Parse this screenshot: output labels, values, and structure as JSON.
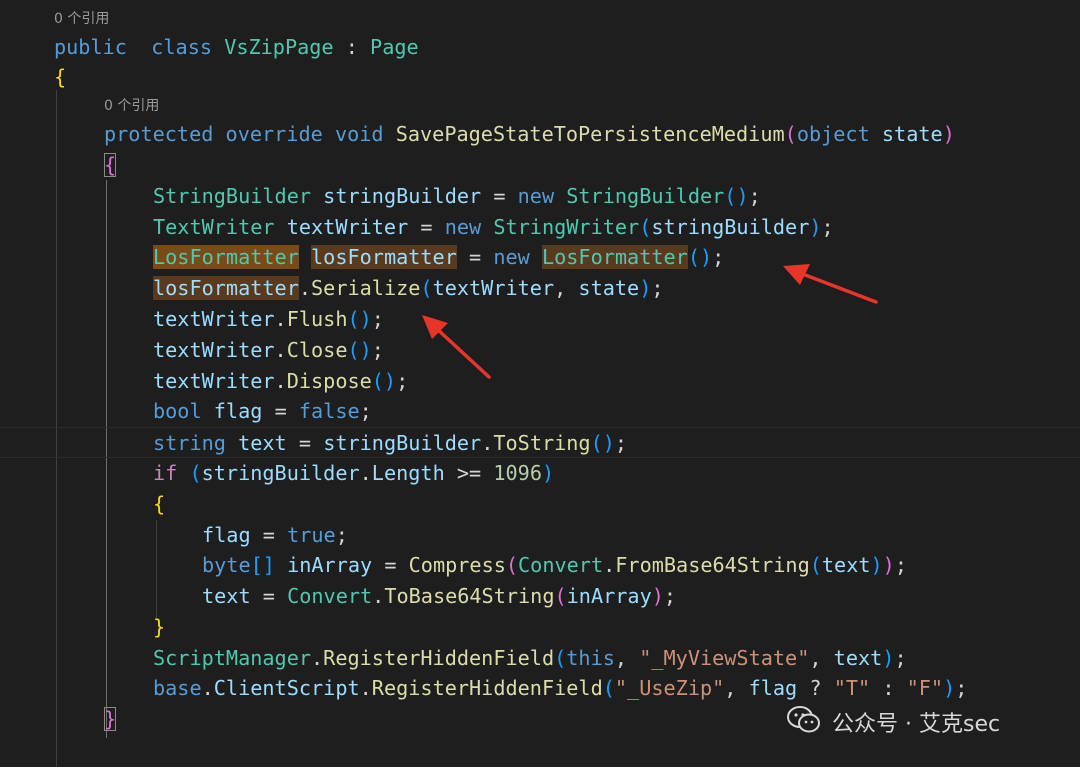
{
  "colors": {
    "background": "#1e1e1e",
    "keyword": "#569cd6",
    "type": "#4ec9b0",
    "variable": "#9cdcfe",
    "function": "#dcdcaa",
    "string": "#ce9178",
    "number": "#b5cea8",
    "highlight": "#5a3a1e",
    "arrow": "#e8352a"
  },
  "code_lens": [
    {
      "text": "0 个引用"
    },
    {
      "text": "0 个引用"
    }
  ],
  "watermark": {
    "icon": "wechat-icon",
    "text": "公众号 · 艾克sec"
  },
  "annotations": [
    {
      "icon": "red-arrow-icon",
      "points_to": "LosFormatter losFormatter = new LosFormatter();"
    },
    {
      "icon": "red-arrow-icon",
      "points_to": "losFormatter.Serialize(textWriter, state);"
    }
  ],
  "code_lines": [
    {
      "lens": 0
    },
    {
      "tokens": [
        [
          "kw",
          "public"
        ],
        [
          "",
          "  "
        ],
        [
          "kw",
          "class"
        ],
        [
          "",
          " "
        ],
        [
          "type",
          "VsZipPage"
        ],
        [
          "",
          " "
        ],
        [
          "op",
          ":"
        ],
        [
          "",
          " "
        ],
        [
          "type",
          "Page"
        ]
      ]
    },
    {
      "tokens": [
        [
          "b1",
          "{"
        ]
      ]
    },
    {
      "lens": 1
    },
    {
      "tokens": [
        [
          "kw",
          "protected"
        ],
        [
          "",
          " "
        ],
        [
          "kw",
          "override"
        ],
        [
          "",
          " "
        ],
        [
          "kw",
          "void"
        ],
        [
          "",
          " "
        ],
        [
          "fn",
          "SavePageStateToPersistenceMedium"
        ],
        [
          "b2",
          "("
        ],
        [
          "kw",
          "object"
        ],
        [
          "",
          " "
        ],
        [
          "var",
          "state"
        ],
        [
          "b2",
          ")"
        ]
      ]
    },
    {
      "tokens": [
        [
          "b2 match",
          "{"
        ]
      ]
    },
    {
      "tokens": [
        [
          "type",
          "StringBuilder"
        ],
        [
          "",
          " "
        ],
        [
          "var",
          "stringBuilder"
        ],
        [
          "",
          " "
        ],
        [
          "op",
          "="
        ],
        [
          "",
          " "
        ],
        [
          "kw",
          "new"
        ],
        [
          "",
          " "
        ],
        [
          "type",
          "StringBuilder"
        ],
        [
          "b3",
          "()"
        ],
        [
          "pun",
          ";"
        ]
      ]
    },
    {
      "tokens": [
        [
          "type",
          "TextWriter"
        ],
        [
          "",
          " "
        ],
        [
          "var",
          "textWriter"
        ],
        [
          "",
          " "
        ],
        [
          "op",
          "="
        ],
        [
          "",
          " "
        ],
        [
          "kw",
          "new"
        ],
        [
          "",
          " "
        ],
        [
          "type",
          "StringWriter"
        ],
        [
          "b3",
          "("
        ],
        [
          "var",
          "stringBuilder"
        ],
        [
          "b3",
          ")"
        ],
        [
          "pun",
          ";"
        ]
      ]
    },
    {
      "tokens": [
        [
          "type hl2",
          "LosFormatter"
        ],
        [
          "",
          " "
        ],
        [
          "var hl",
          "losFormatter"
        ],
        [
          "",
          " "
        ],
        [
          "op",
          "="
        ],
        [
          "",
          " "
        ],
        [
          "kw",
          "new"
        ],
        [
          "",
          " "
        ],
        [
          "type hl",
          "LosFormatter"
        ],
        [
          "b3",
          "()"
        ],
        [
          "pun",
          ";"
        ]
      ]
    },
    {
      "tokens": [
        [
          "var hl",
          "losFormatter"
        ],
        [
          "pun",
          "."
        ],
        [
          "fn",
          "Serialize"
        ],
        [
          "b3",
          "("
        ],
        [
          "var",
          "textWriter"
        ],
        [
          "pun",
          ","
        ],
        [
          "",
          " "
        ],
        [
          "var",
          "state"
        ],
        [
          "b3",
          ")"
        ],
        [
          "pun",
          ";"
        ]
      ]
    },
    {
      "tokens": [
        [
          "var",
          "textWriter"
        ],
        [
          "pun",
          "."
        ],
        [
          "fn",
          "Flush"
        ],
        [
          "b3",
          "()"
        ],
        [
          "pun",
          ";"
        ]
      ]
    },
    {
      "tokens": [
        [
          "var",
          "textWriter"
        ],
        [
          "pun",
          "."
        ],
        [
          "fn",
          "Close"
        ],
        [
          "b3",
          "()"
        ],
        [
          "pun",
          ";"
        ]
      ]
    },
    {
      "tokens": [
        [
          "var",
          "textWriter"
        ],
        [
          "pun",
          "."
        ],
        [
          "fn",
          "Dispose"
        ],
        [
          "b3",
          "()"
        ],
        [
          "pun",
          ";"
        ]
      ]
    },
    {
      "tokens": [
        [
          "kw",
          "bool"
        ],
        [
          "",
          " "
        ],
        [
          "var",
          "flag"
        ],
        [
          "",
          " "
        ],
        [
          "op",
          "="
        ],
        [
          "",
          " "
        ],
        [
          "kw",
          "false"
        ],
        [
          "pun",
          ";"
        ]
      ]
    },
    {
      "tokens": [
        [
          "kw",
          "string"
        ],
        [
          "",
          " "
        ],
        [
          "var",
          "text"
        ],
        [
          "",
          " "
        ],
        [
          "op",
          "="
        ],
        [
          "",
          " "
        ],
        [
          "var",
          "stringBuilder"
        ],
        [
          "pun",
          "."
        ],
        [
          "fn",
          "ToString"
        ],
        [
          "b3",
          "()"
        ],
        [
          "pun",
          ";"
        ]
      ]
    },
    {
      "tokens": [
        [
          "ctl",
          "if"
        ],
        [
          "",
          " "
        ],
        [
          "b3",
          "("
        ],
        [
          "var",
          "stringBuilder"
        ],
        [
          "pun",
          "."
        ],
        [
          "var",
          "Length"
        ],
        [
          "",
          " "
        ],
        [
          "op",
          ">="
        ],
        [
          "",
          " "
        ],
        [
          "num",
          "1096"
        ],
        [
          "b3",
          ")"
        ]
      ]
    },
    {
      "tokens": [
        [
          "b1",
          "{"
        ]
      ]
    },
    {
      "tokens": [
        [
          "var",
          "flag"
        ],
        [
          "",
          " "
        ],
        [
          "op",
          "="
        ],
        [
          "",
          " "
        ],
        [
          "kw",
          "true"
        ],
        [
          "pun",
          ";"
        ]
      ]
    },
    {
      "tokens": [
        [
          "kw",
          "byte"
        ],
        [
          "b3",
          "[]"
        ],
        [
          "",
          " "
        ],
        [
          "var",
          "inArray"
        ],
        [
          "",
          " "
        ],
        [
          "op",
          "="
        ],
        [
          "",
          " "
        ],
        [
          "fn",
          "Compress"
        ],
        [
          "b2",
          "("
        ],
        [
          "type",
          "Convert"
        ],
        [
          "pun",
          "."
        ],
        [
          "fn",
          "FromBase64String"
        ],
        [
          "b3",
          "("
        ],
        [
          "var",
          "text"
        ],
        [
          "b3",
          ")"
        ],
        [
          "b2",
          ")"
        ],
        [
          "pun",
          ";"
        ]
      ]
    },
    {
      "tokens": [
        [
          "var",
          "text"
        ],
        [
          "",
          " "
        ],
        [
          "op",
          "="
        ],
        [
          "",
          " "
        ],
        [
          "type",
          "Convert"
        ],
        [
          "pun",
          "."
        ],
        [
          "fn",
          "ToBase64String"
        ],
        [
          "b2",
          "("
        ],
        [
          "var",
          "inArray"
        ],
        [
          "b2",
          ")"
        ],
        [
          "pun",
          ";"
        ]
      ]
    },
    {
      "tokens": [
        [
          "b1",
          "}"
        ]
      ]
    },
    {
      "tokens": [
        [
          "type",
          "ScriptManager"
        ],
        [
          "pun",
          "."
        ],
        [
          "fn",
          "RegisterHiddenField"
        ],
        [
          "b3",
          "("
        ],
        [
          "kw",
          "this"
        ],
        [
          "pun",
          ","
        ],
        [
          "",
          " "
        ],
        [
          "str",
          "\"_MyViewState\""
        ],
        [
          "pun",
          ","
        ],
        [
          "",
          " "
        ],
        [
          "var",
          "text"
        ],
        [
          "b3",
          ")"
        ],
        [
          "pun",
          ";"
        ]
      ]
    },
    {
      "tokens": [
        [
          "kw",
          "base"
        ],
        [
          "pun",
          "."
        ],
        [
          "var",
          "ClientScript"
        ],
        [
          "pun",
          "."
        ],
        [
          "fn",
          "RegisterHiddenField"
        ],
        [
          "b3",
          "("
        ],
        [
          "str",
          "\"_UseZip\""
        ],
        [
          "pun",
          ","
        ],
        [
          "",
          " "
        ],
        [
          "var",
          "flag"
        ],
        [
          "",
          " "
        ],
        [
          "op",
          "?"
        ],
        [
          "",
          " "
        ],
        [
          "str",
          "\"T\""
        ],
        [
          "",
          " "
        ],
        [
          "op",
          ":"
        ],
        [
          "",
          " "
        ],
        [
          "str",
          "\"F\""
        ],
        [
          "b3",
          ")"
        ],
        [
          "pun",
          ";"
        ]
      ]
    },
    {
      "tokens": [
        [
          "b2 match",
          "}"
        ]
      ]
    }
  ]
}
